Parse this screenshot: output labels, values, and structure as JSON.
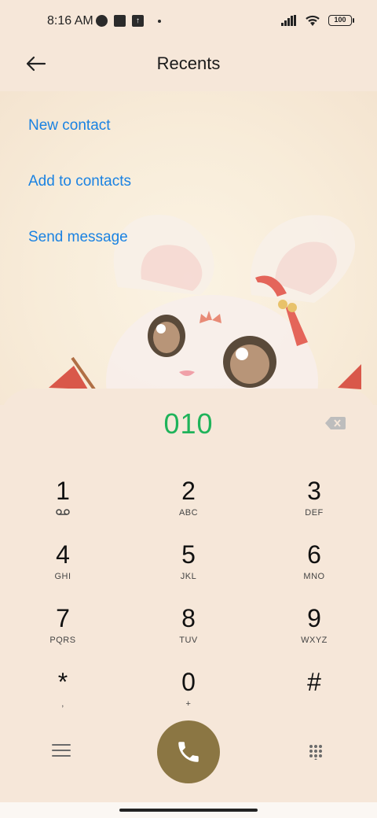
{
  "status": {
    "time": "8:16 AM",
    "battery": "100"
  },
  "header": {
    "title": "Recents"
  },
  "actions": [
    {
      "label": "New contact"
    },
    {
      "label": "Add to contacts"
    },
    {
      "label": "Send message"
    }
  ],
  "dialer": {
    "number": "010",
    "keys": [
      {
        "digit": "1",
        "letters": ""
      },
      {
        "digit": "2",
        "letters": "ABC"
      },
      {
        "digit": "3",
        "letters": "DEF"
      },
      {
        "digit": "4",
        "letters": "GHI"
      },
      {
        "digit": "5",
        "letters": "JKL"
      },
      {
        "digit": "6",
        "letters": "MNO"
      },
      {
        "digit": "7",
        "letters": "PQRS"
      },
      {
        "digit": "8",
        "letters": "TUV"
      },
      {
        "digit": "9",
        "letters": "WXYZ"
      },
      {
        "digit": "*",
        "letters": ","
      },
      {
        "digit": "0",
        "letters": "+"
      },
      {
        "digit": "#",
        "letters": ""
      }
    ]
  },
  "colors": {
    "accent_link": "#1a82e2",
    "number_green": "#1fb35a",
    "call_button": "#8b7643",
    "background": "#f6e7d9"
  },
  "icons": {
    "back": "arrow-left-icon",
    "backspace": "backspace-icon",
    "voicemail": "voicemail-icon",
    "menu": "menu-icon",
    "call": "phone-icon",
    "keypad": "keypad-icon"
  }
}
